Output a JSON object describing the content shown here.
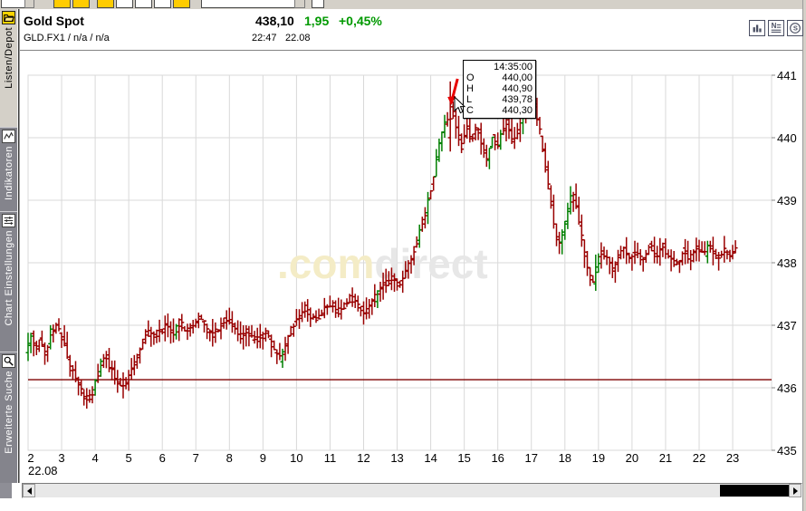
{
  "header": {
    "title": "Gold Spot",
    "instrument_line": "GLD.FX1  /  n/a  /  n/a",
    "price": "438,10",
    "change": "1,95",
    "change_pct": "+0,45%",
    "time": "22:47",
    "date": "22.08",
    "green": "#009900",
    "icons": [
      {
        "name": "bar-chart-icon"
      },
      {
        "name": "news-icon"
      },
      {
        "name": "currency-icon"
      }
    ]
  },
  "sidebar": {
    "tabs": [
      {
        "label": "Listen/Depot",
        "icon": "folder-icon",
        "active": true
      },
      {
        "label": "Indikatoren",
        "icon": "indicator-icon",
        "active": false
      },
      {
        "label": "Chart Einstellungen",
        "icon": "chart-settings-icon",
        "active": false
      },
      {
        "label": "Erweiterte Suche",
        "icon": "magnifier-icon",
        "active": false
      }
    ]
  },
  "chart_data": {
    "type": "ohlc",
    "title": "Gold Spot intraday 22.08",
    "x_unit": "hours",
    "x_ticks": [
      2,
      3,
      4,
      5,
      6,
      7,
      8,
      9,
      10,
      11,
      12,
      13,
      14,
      15,
      16,
      17,
      18,
      19,
      20,
      21,
      22,
      23
    ],
    "x_date_label": "22.08",
    "y_ticks": [
      441,
      440,
      439,
      438,
      437,
      436,
      435
    ],
    "ylim": [
      435,
      441.35
    ],
    "grid": true,
    "bar_interval_hours": 0.0833333,
    "reference_line": 436.13,
    "colors": {
      "down": "#990000",
      "up": "#007f00",
      "grid": "#d9d9d9",
      "reference": "#7f0000",
      "axis_text": "#000000"
    },
    "seed": 42,
    "noise": {
      "oc": 0.12,
      "wick": 0.2,
      "green_threshold": 0.14
    },
    "price_path": [
      [
        2.0,
        436.55
      ],
      [
        2.15,
        436.85
      ],
      [
        2.3,
        436.6
      ],
      [
        2.45,
        436.8
      ],
      [
        2.6,
        436.55
      ],
      [
        2.75,
        436.9
      ],
      [
        2.9,
        437.0
      ],
      [
        3.05,
        436.85
      ],
      [
        3.2,
        436.6
      ],
      [
        3.35,
        436.3
      ],
      [
        3.5,
        436.15
      ],
      [
        3.65,
        435.95
      ],
      [
        3.8,
        435.8
      ],
      [
        3.95,
        435.85
      ],
      [
        4.1,
        436.1
      ],
      [
        4.25,
        436.4
      ],
      [
        4.4,
        436.5
      ],
      [
        4.55,
        436.3
      ],
      [
        4.7,
        436.15
      ],
      [
        4.85,
        436.05
      ],
      [
        5.0,
        436.1
      ],
      [
        5.15,
        436.3
      ],
      [
        5.3,
        436.45
      ],
      [
        5.45,
        436.7
      ],
      [
        5.6,
        436.9
      ],
      [
        5.8,
        436.8
      ],
      [
        6.0,
        436.9
      ],
      [
        6.2,
        437.0
      ],
      [
        6.4,
        436.85
      ],
      [
        6.6,
        437.05
      ],
      [
        6.8,
        436.9
      ],
      [
        7.0,
        437.0
      ],
      [
        7.2,
        437.15
      ],
      [
        7.4,
        436.95
      ],
      [
        7.6,
        436.85
      ],
      [
        7.8,
        437.0
      ],
      [
        8.0,
        437.1
      ],
      [
        8.2,
        436.95
      ],
      [
        8.4,
        436.8
      ],
      [
        8.6,
        436.9
      ],
      [
        8.8,
        436.75
      ],
      [
        9.0,
        436.8
      ],
      [
        9.2,
        436.9
      ],
      [
        9.4,
        436.6
      ],
      [
        9.6,
        436.45
      ],
      [
        9.75,
        436.7
      ],
      [
        9.9,
        436.9
      ],
      [
        10.1,
        437.1
      ],
      [
        10.3,
        437.3
      ],
      [
        10.5,
        437.15
      ],
      [
        10.7,
        437.05
      ],
      [
        10.9,
        437.25
      ],
      [
        11.1,
        437.35
      ],
      [
        11.3,
        437.2
      ],
      [
        11.5,
        437.3
      ],
      [
        11.7,
        437.45
      ],
      [
        11.9,
        437.35
      ],
      [
        12.1,
        437.2
      ],
      [
        12.3,
        437.35
      ],
      [
        12.5,
        437.5
      ],
      [
        12.7,
        437.65
      ],
      [
        12.9,
        437.75
      ],
      [
        13.1,
        437.65
      ],
      [
        13.3,
        437.8
      ],
      [
        13.5,
        438.05
      ],
      [
        13.7,
        438.4
      ],
      [
        13.9,
        438.75
      ],
      [
        14.1,
        439.25
      ],
      [
        14.3,
        439.8
      ],
      [
        14.45,
        440.15
      ],
      [
        14.583,
        440.3
      ],
      [
        14.7,
        440.5
      ],
      [
        14.85,
        440.1
      ],
      [
        15.0,
        439.85
      ],
      [
        15.15,
        440.15
      ],
      [
        15.3,
        439.95
      ],
      [
        15.45,
        440.2
      ],
      [
        15.6,
        439.85
      ],
      [
        15.75,
        439.65
      ],
      [
        15.9,
        440.05
      ],
      [
        16.05,
        439.85
      ],
      [
        16.2,
        440.1
      ],
      [
        16.35,
        440.25
      ],
      [
        16.5,
        439.95
      ],
      [
        16.65,
        440.1
      ],
      [
        16.8,
        440.3
      ],
      [
        16.95,
        440.6
      ],
      [
        17.1,
        440.65
      ],
      [
        17.25,
        440.3
      ],
      [
        17.4,
        439.9
      ],
      [
        17.55,
        439.3
      ],
      [
        17.7,
        438.85
      ],
      [
        17.85,
        438.3
      ],
      [
        18.0,
        438.45
      ],
      [
        18.15,
        438.85
      ],
      [
        18.3,
        439.1
      ],
      [
        18.45,
        438.8
      ],
      [
        18.6,
        438.35
      ],
      [
        18.75,
        437.9
      ],
      [
        18.9,
        437.65
      ],
      [
        19.05,
        438.0
      ],
      [
        19.2,
        438.2
      ],
      [
        19.35,
        438.05
      ],
      [
        19.5,
        437.9
      ],
      [
        19.65,
        438.1
      ],
      [
        19.8,
        438.25
      ],
      [
        20.0,
        438.05
      ],
      [
        20.2,
        438.2
      ],
      [
        20.4,
        438.0
      ],
      [
        20.6,
        438.3
      ],
      [
        20.8,
        438.1
      ],
      [
        21.0,
        438.25
      ],
      [
        21.2,
        438.05
      ],
      [
        21.4,
        437.95
      ],
      [
        21.6,
        438.2
      ],
      [
        21.8,
        438.05
      ],
      [
        22.0,
        438.25
      ],
      [
        22.2,
        438.1
      ],
      [
        22.4,
        438.3
      ],
      [
        22.6,
        438.05
      ],
      [
        22.8,
        438.2
      ],
      [
        23.0,
        438.1
      ],
      [
        23.15,
        438.2
      ]
    ],
    "highlight": {
      "t": 14.5833,
      "time_label": "14:35:00",
      "o": "440,00",
      "h": "440,90",
      "l": "439,78",
      "c": "440,30",
      "o_num": 440.0,
      "h_num": 440.9,
      "l_num": 439.78,
      "c_num": 440.3
    },
    "ohlc_labels": {
      "o": "O",
      "h": "H",
      "l": "L",
      "c": "C"
    },
    "watermark": {
      "part1": ".com",
      "part2": "direct",
      "color1": "#f4ecc6",
      "color2": "#e7e7e7"
    },
    "annotation_arrow": {
      "color": "#e80000"
    }
  },
  "scrollbar": {
    "thumb_left": 770,
    "thumb_width": 77
  }
}
